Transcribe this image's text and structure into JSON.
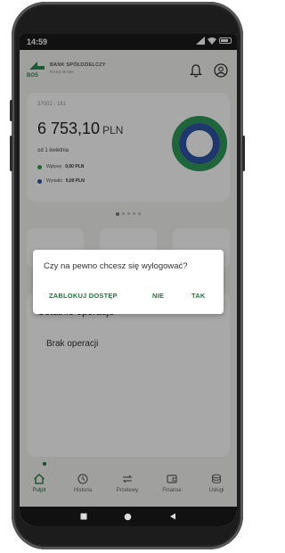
{
  "status_bar": {
    "time": "14:59"
  },
  "header": {
    "bank_name": "BANK SPÓŁDZIELCZY",
    "bank_sub": "NASZ BANK",
    "logo_text": "BOŚ"
  },
  "account": {
    "number": "37002 - 161",
    "balance": "6 753,10",
    "currency": "PLN",
    "since": "od 1 kwietnia",
    "incoming_label": "Wpływy",
    "incoming_value": "0,00 PLN",
    "outgoing_label": "Wydatki",
    "outgoing_value": "0,00 PLN"
  },
  "operations": {
    "title": "Ostatnie operacje",
    "empty": "Brak operacji"
  },
  "bottom_nav": [
    {
      "label": "Pulpit",
      "icon": "home-icon"
    },
    {
      "label": "Historia",
      "icon": "history-icon"
    },
    {
      "label": "Przelewy",
      "icon": "transfer-icon"
    },
    {
      "label": "Finanse",
      "icon": "finance-icon"
    },
    {
      "label": "Usługi",
      "icon": "services-icon"
    }
  ],
  "dialog": {
    "question": "Czy na pewno chcesz się wylogować?",
    "block_label": "ZABLOKUJ DOSTĘP",
    "no_label": "NIE",
    "yes_label": "TAK"
  },
  "colors": {
    "accent_green": "#1d7a3b",
    "donut_outer": "#2e9a5a",
    "donut_inner": "#2f55a4",
    "overlay": "rgba(0,0,0,0.34)"
  }
}
